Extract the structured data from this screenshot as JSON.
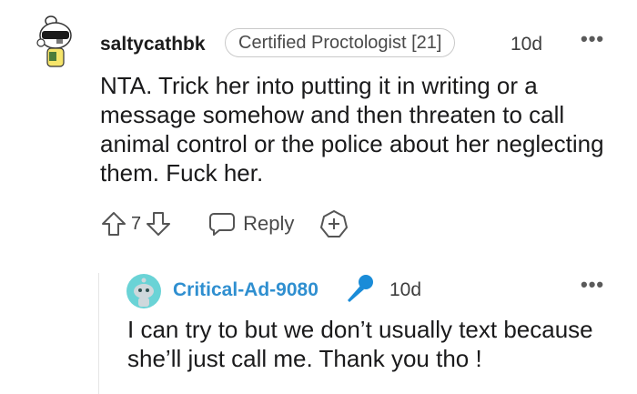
{
  "top_comment": {
    "username": "saltycathbk",
    "flair": "Certified Proctologist [21]",
    "time": "10d",
    "more": "•••",
    "body": "NTA. Trick her into putting it in writing or a message somehow and then threaten to call animal control or the police about her neglecting them. Fuck her.",
    "vote_count": "7",
    "reply_label": "Reply"
  },
  "reply_comment": {
    "username": "Critical-Ad-9080",
    "time": "10d",
    "more": "•••",
    "body": "I can try to but we don’t usually text because she’ll just call me. Thank you tho !"
  },
  "colors": {
    "username_reply": "#2f8fd0",
    "mic": "#1a8cd8",
    "avatar_reply_bg": "#6ad3d6"
  }
}
